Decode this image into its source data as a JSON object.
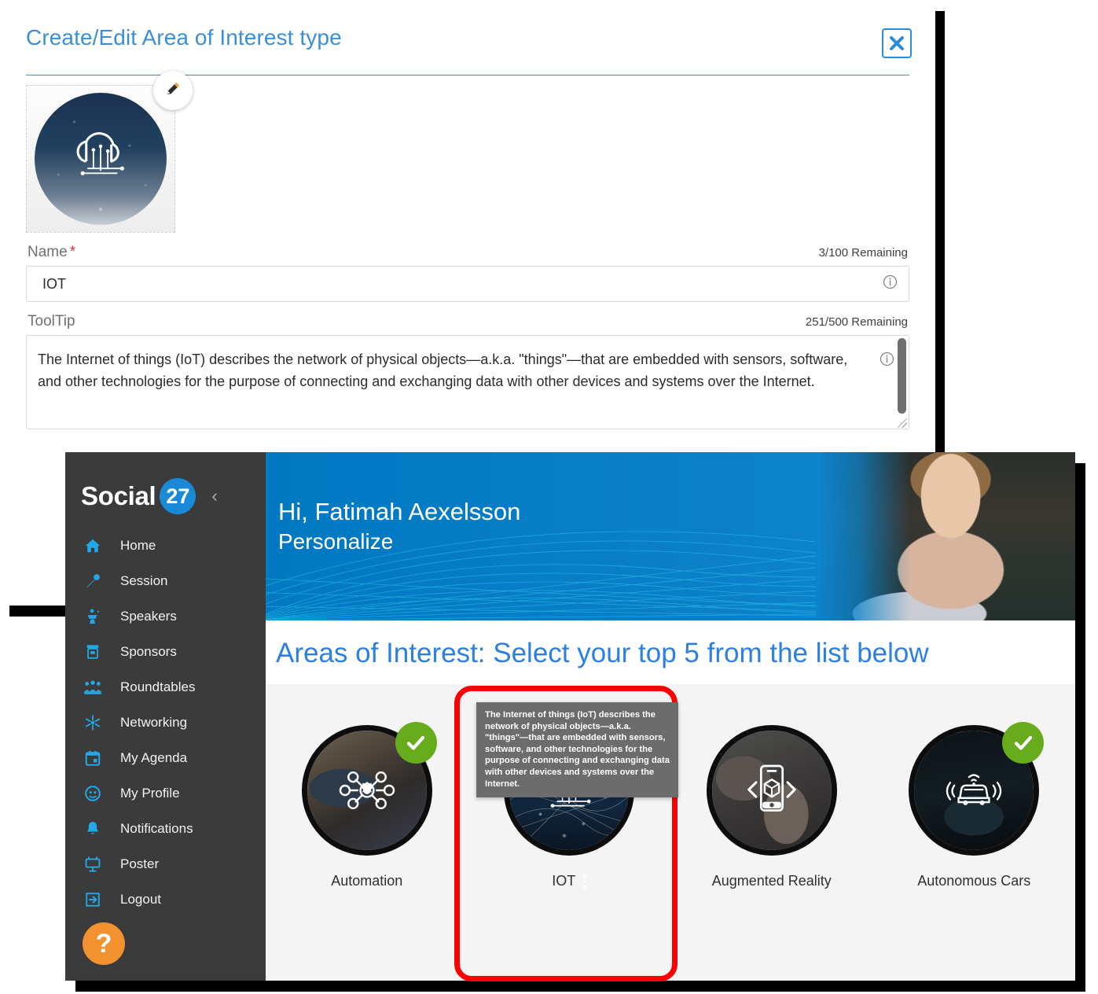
{
  "dialog": {
    "title": "Create/Edit Area of Interest type",
    "close_label": "×",
    "close_icon": "close-icon",
    "edit_icon": "pencil-icon",
    "name": {
      "label": "Name",
      "required_mark": "*",
      "counter": "3/100 Remaining",
      "value": "IOT",
      "info_icon": "info-icon"
    },
    "tooltip_field": {
      "label": "ToolTip",
      "counter": "251/500 Remaining",
      "value": "The Internet of things (IoT) describes the network of physical objects—a.k.a. \"things\"—that are embedded with sensors, software, and other technologies for the purpose of connecting and exchanging data with other devices and systems over the Internet.",
      "info_icon": "info-icon"
    }
  },
  "app": {
    "brand": {
      "name": "Social",
      "badge": "27",
      "collapse_icon": "chevron-left-icon"
    },
    "sidebar": {
      "items": [
        {
          "label": "Home",
          "icon": "home-icon"
        },
        {
          "label": "Session",
          "icon": "microphone-icon"
        },
        {
          "label": "Speakers",
          "icon": "podium-icon"
        },
        {
          "label": "Sponsors",
          "icon": "booth-icon"
        },
        {
          "label": "Roundtables",
          "icon": "people-group-icon"
        },
        {
          "label": "Networking",
          "icon": "network-nodes-icon"
        },
        {
          "label": "My Agenda",
          "icon": "calendar-icon"
        },
        {
          "label": "My Profile",
          "icon": "user-circle-icon"
        },
        {
          "label": "Notifications",
          "icon": "bell-icon"
        },
        {
          "label": "Poster",
          "icon": "poster-board-icon"
        },
        {
          "label": "Logout",
          "icon": "logout-arrow-icon"
        }
      ],
      "help_label": "?",
      "help_icon": "question-mark-icon"
    },
    "banner": {
      "greeting": "Hi, Fatimah Aexelsson",
      "subtitle": "Personalize"
    },
    "section_title": "Areas of Interest: Select your top 5 from the list below",
    "cards": [
      {
        "label": "Automation",
        "selected": true,
        "image": "person-with-tablet-photo",
        "glyph": "automation-network-icon"
      },
      {
        "label": "IOT",
        "selected": true,
        "image": "smart-city-night-photo",
        "glyph": "cloud-circuit-icon",
        "has_kebab": true
      },
      {
        "label": "Augmented Reality",
        "selected": false,
        "image": "vr-headset-people-photo",
        "glyph": "phone-ar-cube-icon"
      },
      {
        "label": "Autonomous Cars",
        "selected": true,
        "image": "car-dashboard-photo",
        "glyph": "self-driving-car-icon"
      }
    ],
    "card_tooltip": "The Internet of things (IoT) describes the network of physical objects—a.k.a. \"things\"—that are embedded with sensors, software, and other technologies for the purpose of connecting and exchanging data with other devices and systems over the Internet."
  },
  "colors": {
    "accent_blue": "#2d7fe0",
    "dialog_title_blue": "#3b8fd4",
    "brand_blue": "#1b8ad6",
    "banner_blue": "#0c84cc",
    "sidebar_dark": "#3b3b3b",
    "check_green": "#67ac1c",
    "help_orange": "#f2912f",
    "highlight_red": "#fb0304",
    "required_red": "#e2373c",
    "tooltip_gray": "#6c6c6c"
  }
}
